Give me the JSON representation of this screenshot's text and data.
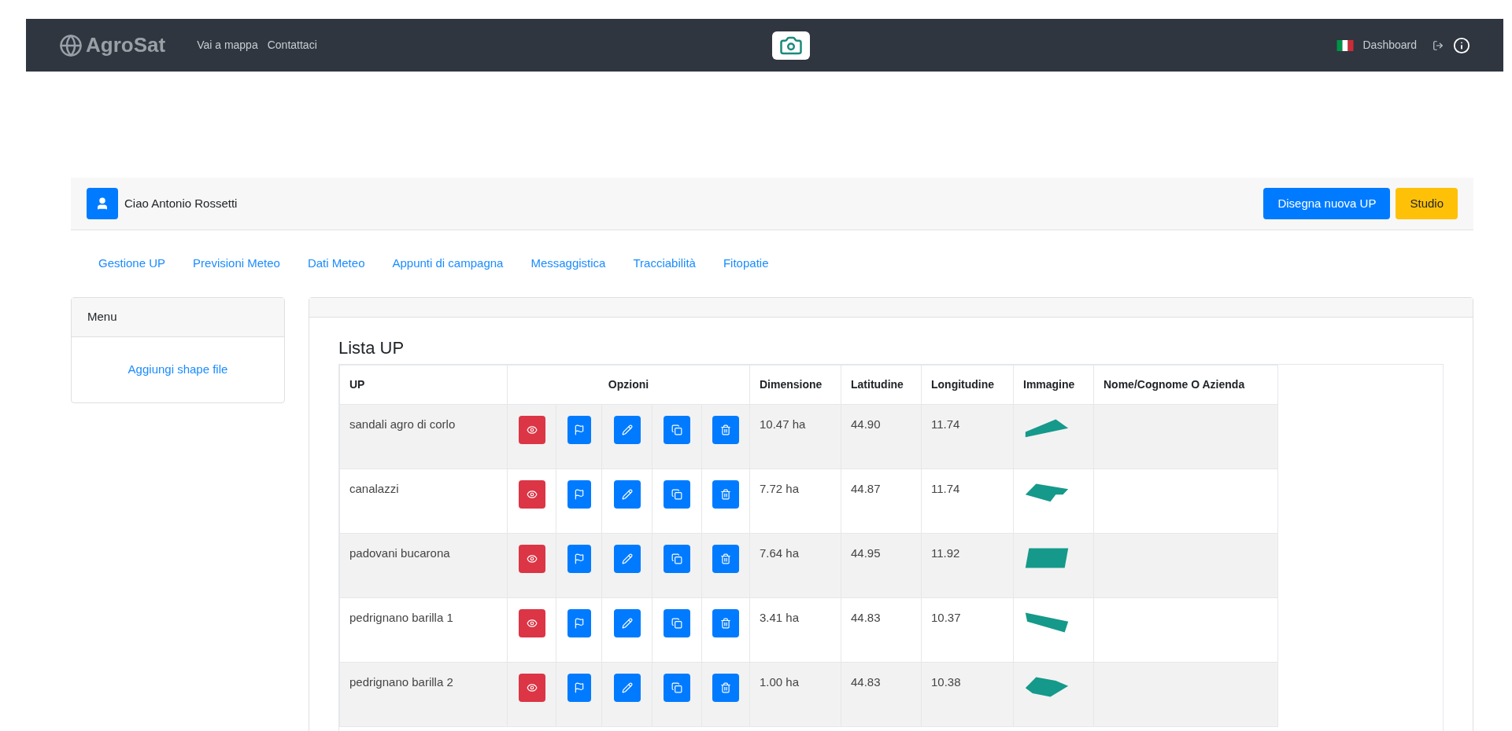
{
  "navbar": {
    "logo": "AgroSat",
    "links": [
      "Vai a mappa",
      "Contattaci"
    ],
    "right_link": "Dashboard"
  },
  "user_bar": {
    "greeting": "Ciao Antonio Rossetti",
    "buttons": [
      {
        "label": "Disegna nuova UP",
        "kind": "primary"
      },
      {
        "label": "Studio",
        "kind": "warning"
      }
    ]
  },
  "tabs": [
    "Gestione UP",
    "Previsioni Meteo",
    "Dati Meteo",
    "Appunti di campagna",
    "Messaggistica",
    "Tracciabilità",
    "Fitopatie"
  ],
  "menu": {
    "title": "Menu",
    "items": [
      "Aggiungi shape file"
    ]
  },
  "list": {
    "title": "Lista UP",
    "columns": [
      "UP",
      "Opzioni",
      "Dimensione",
      "Latitudine",
      "Longitudine",
      "Immagine",
      "Nome/Cognome O Azienda"
    ],
    "rows": [
      {
        "up": "sandali agro di corlo",
        "dimensione": "10.47 ha",
        "latitudine": "44.90",
        "longitudine": "11.74"
      },
      {
        "up": "canalazzi",
        "dimensione": "7.72 ha",
        "latitudine": "44.87",
        "longitudine": "11.74"
      },
      {
        "up": "padovani bucarona",
        "dimensione": "7.64 ha",
        "latitudine": "44.95",
        "longitudine": "11.92"
      },
      {
        "up": "pedrignano barilla 1",
        "dimensione": "3.41 ha",
        "latitudine": "44.83",
        "longitudine": "10.37"
      },
      {
        "up": "pedrignano barilla 2",
        "dimensione": "1.00 ha",
        "latitudine": "44.83",
        "longitudine": "10.38"
      }
    ]
  }
}
